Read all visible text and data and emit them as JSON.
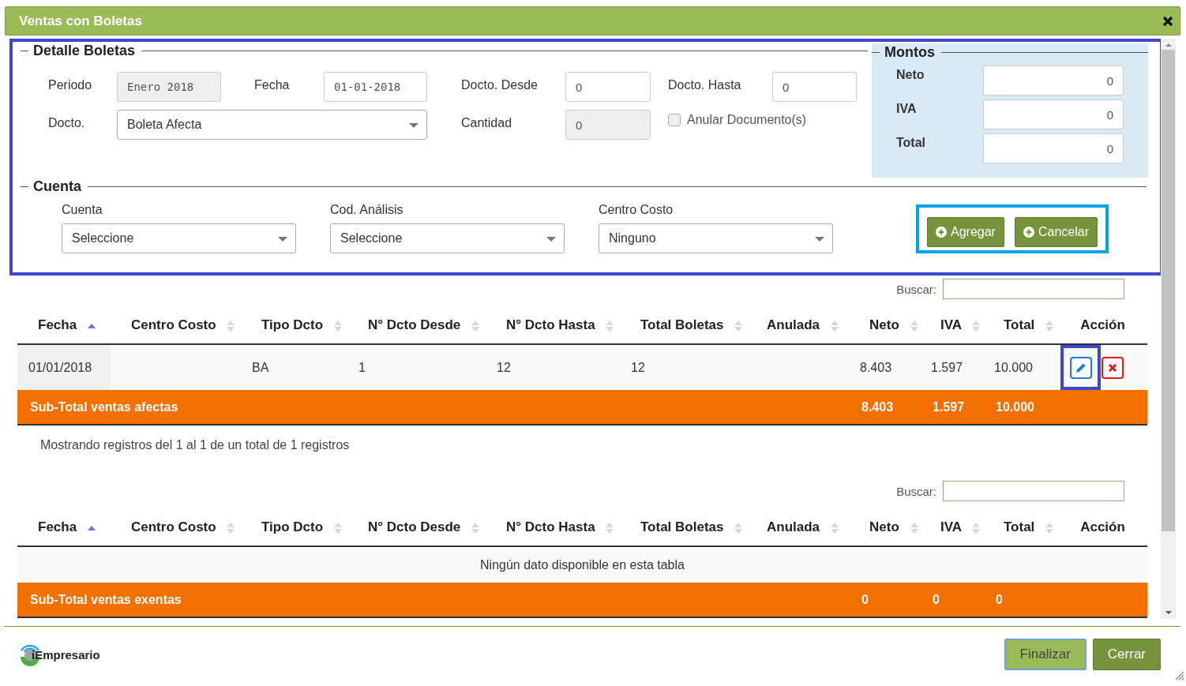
{
  "window": {
    "title": "Ventas con Boletas"
  },
  "detalle": {
    "title": "Detalle Boletas",
    "periodo": {
      "label": "Periodo",
      "value": "Enero 2018",
      "disabled": true
    },
    "fecha": {
      "label": "Fecha",
      "value": "01-01-2018",
      "disabled": false
    },
    "docto_desde": {
      "label": "Docto. Desde",
      "value": "0",
      "disabled": false
    },
    "docto_hasta": {
      "label": "Docto. Hasta",
      "value": "0",
      "disabled": false
    },
    "docto": {
      "label": "Docto.",
      "value": "Boleta Afecta"
    },
    "cantidad": {
      "label": "Cantidad",
      "value": "0",
      "disabled": true
    },
    "anular": {
      "label": "Anular Documento(s)",
      "checked": false
    }
  },
  "montos": {
    "title": "Montos",
    "rows": [
      {
        "label": "Neto",
        "value": "0"
      },
      {
        "label": "IVA",
        "value": "0"
      },
      {
        "label": "Total",
        "value": "0"
      }
    ]
  },
  "cuenta": {
    "title": "Cuenta",
    "fields": [
      {
        "label": "Cuenta",
        "value": "Seleccione"
      },
      {
        "label": "Cod. Análisis",
        "value": "Seleccione"
      },
      {
        "label": "Centro Costo",
        "value": "Ninguno"
      }
    ]
  },
  "form_buttons": [
    "Agregar",
    "Cancelar"
  ],
  "tables": [
    {
      "search_label": "Buscar:",
      "columns": [
        {
          "label": "Fecha",
          "sortable": true,
          "sorted": true
        },
        {
          "label": "Centro Costo",
          "sortable": true,
          "sorted": false
        },
        {
          "label": "Tipo Dcto",
          "sortable": true,
          "sorted": false
        },
        {
          "label": "N° Dcto Desde",
          "sortable": true,
          "sorted": false
        },
        {
          "label": "N° Dcto Hasta",
          "sortable": true,
          "sorted": false
        },
        {
          "label": "Total Boletas",
          "sortable": true,
          "sorted": false
        },
        {
          "label": "Anulada",
          "sortable": true,
          "sorted": false
        },
        {
          "label": "Neto",
          "sortable": true,
          "sorted": false
        },
        {
          "label": "IVA",
          "sortable": true,
          "sorted": false
        },
        {
          "label": "Total",
          "sortable": true,
          "sorted": false
        },
        {
          "label": "Acción",
          "sortable": false,
          "kind": "actions"
        }
      ],
      "rows": [
        {
          "cells": [
            "01/01/2018",
            null,
            "BA",
            "1",
            "12",
            "12",
            null,
            "8.403",
            "1.597",
            "10.000"
          ]
        }
      ],
      "subtotal": {
        "label": "Sub-Total ventas afectas",
        "values": [
          "8.403",
          "1.597",
          "10.000"
        ]
      },
      "info": "Mostrando registros del 1 al 1 de un total de 1 registros"
    },
    {
      "search_label": "Buscar:",
      "columns": [
        {
          "label": "Fecha",
          "sortable": true,
          "sorted": true
        },
        {
          "label": "Centro Costo",
          "sortable": true,
          "sorted": false
        },
        {
          "label": "Tipo Dcto",
          "sortable": true,
          "sorted": false
        },
        {
          "label": "N° Dcto Desde",
          "sortable": true,
          "sorted": false
        },
        {
          "label": "N° Dcto Hasta",
          "sortable": true,
          "sorted": false
        },
        {
          "label": "Total Boletas",
          "sortable": true,
          "sorted": false
        },
        {
          "label": "Anulada",
          "sortable": true,
          "sorted": false
        },
        {
          "label": "Neto",
          "sortable": true,
          "sorted": false
        },
        {
          "label": "IVA",
          "sortable": true,
          "sorted": false
        },
        {
          "label": "Total",
          "sortable": true,
          "sorted": false
        },
        {
          "label": "Acción",
          "sortable": false,
          "kind": "actions"
        }
      ],
      "empty": "Ningún dato disponible en esta tabla",
      "subtotal": {
        "label": "Sub-Total ventas exentas",
        "values": [
          "0",
          "0",
          "0"
        ]
      }
    }
  ],
  "footer": {
    "logo": "iEmpresario",
    "buttons": [
      {
        "label": "Finalizar",
        "focused": true
      },
      {
        "label": "Cerrar",
        "focused": false
      }
    ]
  }
}
